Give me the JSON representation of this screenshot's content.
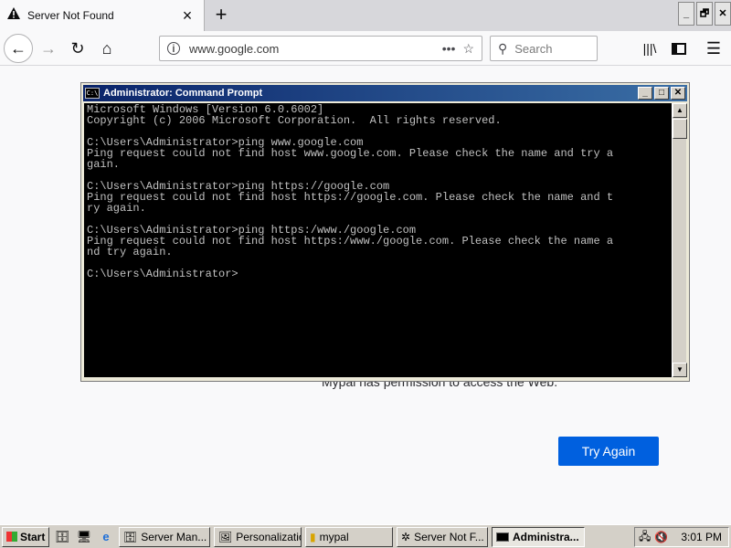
{
  "browser": {
    "tab": {
      "title": "Server Not Found",
      "warning_icon": "warning-icon",
      "close_label": "×"
    },
    "new_tab_label": "+",
    "window_buttons": [
      "_",
      "🗗",
      "✕"
    ],
    "url": "www.google.com",
    "search_placeholder": "Search"
  },
  "page": {
    "error_text": "Mypal has permission to access the Web.",
    "try_again_label": "Try Again",
    "accent_color": "#0060df"
  },
  "cmd": {
    "title": "Administrator: Command Prompt",
    "icon_label": "C:\\",
    "window_buttons": [
      "_",
      "□",
      "✕"
    ],
    "lines": [
      "Microsoft Windows [Version 6.0.6002]",
      "Copyright (c) 2006 Microsoft Corporation.  All rights reserved.",
      "",
      "C:\\Users\\Administrator>ping www.google.com",
      "Ping request could not find host www.google.com. Please check the name and try a",
      "gain.",
      "",
      "C:\\Users\\Administrator>ping https://google.com",
      "Ping request could not find host https://google.com. Please check the name and t",
      "ry again.",
      "",
      "C:\\Users\\Administrator>ping https:/www./google.com",
      "Ping request could not find host https:/www./google.com. Please check the name a",
      "nd try again.",
      "",
      "C:\\Users\\Administrator>"
    ]
  },
  "taskbar": {
    "start_label": "Start",
    "items": [
      {
        "label": "Server Man...",
        "active": false
      },
      {
        "label": "Personalization",
        "active": false
      },
      {
        "label": "mypal",
        "active": false
      },
      {
        "label": "Server Not F...",
        "active": false
      },
      {
        "label": "Administra...",
        "active": true
      }
    ],
    "clock": "3:01 PM"
  }
}
